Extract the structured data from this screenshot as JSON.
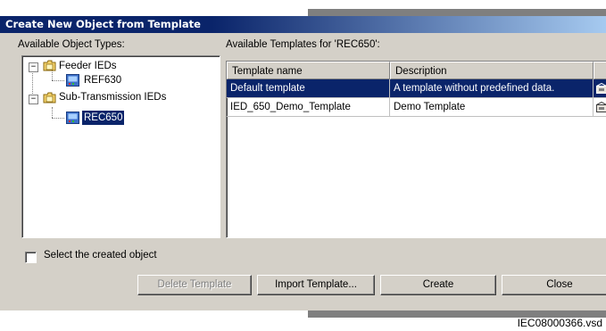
{
  "dialog": {
    "title": "Create New Object from Template"
  },
  "object_types": {
    "label": "Available Object Types:",
    "tree": [
      {
        "label": "Feeder IEDs",
        "children": [
          {
            "label": "REF630"
          }
        ]
      },
      {
        "label": "Sub-Transmission IEDs",
        "children": [
          {
            "label": "REC650",
            "selected": true
          }
        ]
      }
    ],
    "expander_symbol": "−"
  },
  "templates": {
    "label": "Available Templates for 'REC650':",
    "columns": [
      "Template name",
      "Description"
    ],
    "rows": [
      {
        "name": "Default template",
        "description": "A template without predefined data.",
        "selected": true
      },
      {
        "name": "IED_650_Demo_Template",
        "description": "Demo Template",
        "selected": false
      }
    ]
  },
  "select_created": {
    "label": "Select the created object",
    "checked": false
  },
  "buttons": {
    "delete": "Delete Template",
    "import": "Import Template...",
    "create": "Create",
    "close": "Close"
  },
  "footer": {
    "filename": "IEC08000366.vsd"
  },
  "colors": {
    "selection": "#0a246a",
    "dialog_bg": "#d4d0c8",
    "title_gradient_end": "#a6caf0"
  },
  "icons": {
    "group": "folder-icon",
    "device": "ied-device-icon",
    "template": "template-icon"
  }
}
